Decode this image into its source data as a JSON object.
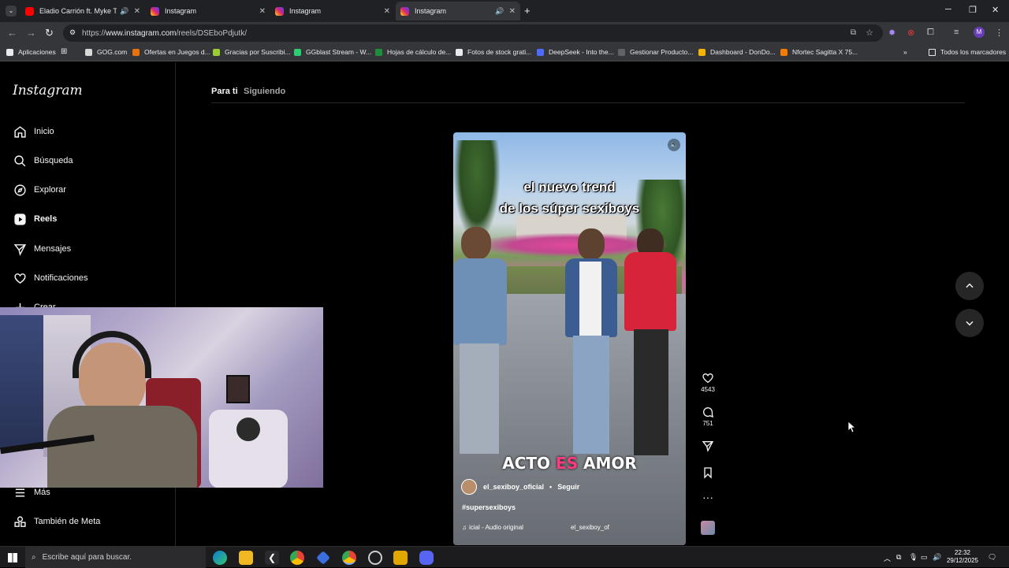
{
  "browser": {
    "tabs": [
      {
        "title": "Eladio Carrión ft. Myke Towe",
        "favicon": "youtube-icon",
        "audio": true
      },
      {
        "title": "Instagram",
        "favicon": "instagram-icon",
        "audio": false
      },
      {
        "title": "Instagram",
        "favicon": "instagram-icon",
        "audio": false
      },
      {
        "title": "Instagram",
        "favicon": "instagram-icon",
        "audio": true,
        "active": true
      }
    ],
    "url_prefix": "https://",
    "url_host": "www.instagram.com",
    "url_path": "/reels/DSEboPdjutk/",
    "profile_initial": "M",
    "bookmarks": [
      "Aplicaciones",
      "GOG.com",
      "Ofertas en Juegos d...",
      "Gracias por Suscribi...",
      "GGblast Stream - W...",
      "Hojas de cálculo de...",
      "Fotos de stock grati...",
      "DeepSeek - Into the...",
      "Gestionar Producto...",
      "Dashboard - DonDo...",
      "Nfortec Sagitta X 75..."
    ],
    "bookmarks_more": "»",
    "all_bookmarks": "Todos los marcadores"
  },
  "instagram": {
    "logo": "Instagram",
    "nav": [
      {
        "label": "Inicio",
        "icon": "home-icon"
      },
      {
        "label": "Búsqueda",
        "icon": "search-icon"
      },
      {
        "label": "Explorar",
        "icon": "compass-icon"
      },
      {
        "label": "Reels",
        "icon": "reels-icon"
      },
      {
        "label": "Mensajes",
        "icon": "messages-icon"
      },
      {
        "label": "Notificaciones",
        "icon": "heart-icon"
      },
      {
        "label": "Crear",
        "icon": "plus-icon"
      }
    ],
    "nav_bottom": [
      {
        "label": "Más",
        "icon": "menu-icon"
      },
      {
        "label": "También de Meta",
        "icon": "meta-icon"
      }
    ],
    "feed_tabs": [
      {
        "label": "Para ti",
        "active": true
      },
      {
        "label": "Siguiendo",
        "active": false
      }
    ],
    "reel": {
      "caption_line1": "el nuevo trend",
      "caption_line2": "de los súper sexiboys",
      "overlay_word1": "ACTO",
      "overlay_word2": "ES",
      "overlay_word3": "AMOR",
      "username": "el_sexiboy_oficial",
      "dot": "•",
      "follow": "Seguir",
      "hashtag": "#supersexiboys",
      "audio": "icial - Audio original",
      "audio_user": "el_sexiboy_of",
      "likes": "4543",
      "comments": "751"
    }
  },
  "taskbar": {
    "search_placeholder": "Escribe aquí para buscar.",
    "time": "22:32",
    "date": "29/12/2025"
  }
}
